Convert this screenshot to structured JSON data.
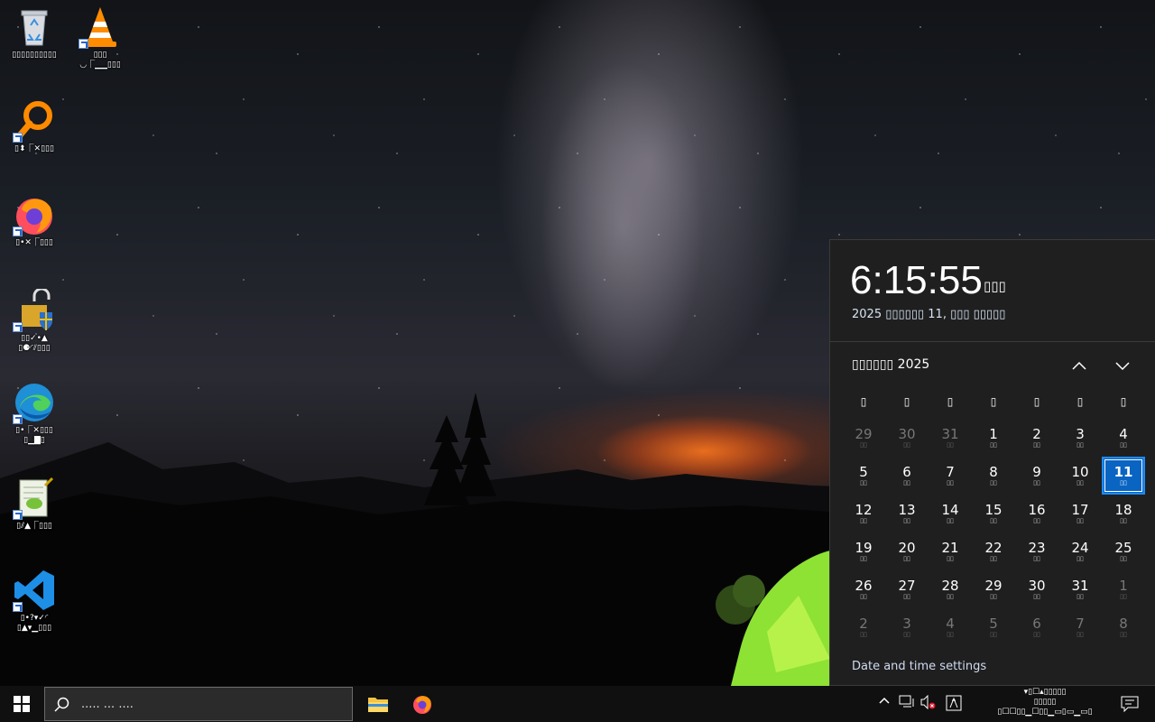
{
  "desktop": {
    "icons": [
      {
        "name": "recycle-bin",
        "label": "▯▯▯▯▯▯▯▯▯▯"
      },
      {
        "name": "vlc",
        "label": "▯▯▯\n◡⎾▁▁▯▯▯"
      },
      {
        "name": "search-app",
        "label": "▯⬍⎾✕▯▯▯"
      },
      {
        "name": "firefox",
        "label": "▯•✕⎾▯▯▯"
      },
      {
        "name": "security-app",
        "label": "▯▯✓•▲\n▯⚈◜⫽▯▯▯"
      },
      {
        "name": "edge",
        "label": "▯•⎾✕▯▯▯\n▯▁▇▯"
      },
      {
        "name": "notepad-app",
        "label": "▯⫽▲⎾▯▯▯"
      },
      {
        "name": "vscode",
        "label": "▯•?▾✓◜\n▯▲▾▁▯▯▯"
      }
    ]
  },
  "flyout": {
    "time": "6:15:55",
    "ampm": "▯▯▯",
    "date": "2025 ▯▯▯▯▯▯ 11, ▯▯▯ ▯▯▯▯▯",
    "month_title": "▯▯▯▯▯▯ 2025",
    "weekdays": [
      "▯",
      "▯",
      "▯",
      "▯",
      "▯",
      "▯",
      "▯"
    ],
    "days": [
      {
        "n": "29",
        "s": "▯▯",
        "dim": true
      },
      {
        "n": "30",
        "s": "▯▯",
        "dim": true
      },
      {
        "n": "31",
        "s": "▯▯",
        "dim": true
      },
      {
        "n": "1",
        "s": "▯▯"
      },
      {
        "n": "2",
        "s": "▯▯"
      },
      {
        "n": "3",
        "s": "▯▯"
      },
      {
        "n": "4",
        "s": "▯▯"
      },
      {
        "n": "5",
        "s": "▯▯"
      },
      {
        "n": "6",
        "s": "▯▯"
      },
      {
        "n": "7",
        "s": "▯▯"
      },
      {
        "n": "8",
        "s": "▯▯"
      },
      {
        "n": "9",
        "s": "▯▯"
      },
      {
        "n": "10",
        "s": "▯▯"
      },
      {
        "n": "11",
        "s": "▯▯",
        "today": true
      },
      {
        "n": "12",
        "s": "▯▯"
      },
      {
        "n": "13",
        "s": "▯▯"
      },
      {
        "n": "14",
        "s": "▯▯"
      },
      {
        "n": "15",
        "s": "▯▯"
      },
      {
        "n": "16",
        "s": "▯▯"
      },
      {
        "n": "17",
        "s": "▯▯"
      },
      {
        "n": "18",
        "s": "▯▯"
      },
      {
        "n": "19",
        "s": "▯▯"
      },
      {
        "n": "20",
        "s": "▯▯"
      },
      {
        "n": "21",
        "s": "▯▯"
      },
      {
        "n": "22",
        "s": "▯▯"
      },
      {
        "n": "23",
        "s": "▯▯"
      },
      {
        "n": "24",
        "s": "▯▯"
      },
      {
        "n": "25",
        "s": "▯▯"
      },
      {
        "n": "26",
        "s": "▯▯"
      },
      {
        "n": "27",
        "s": "▯▯"
      },
      {
        "n": "28",
        "s": "▯▯"
      },
      {
        "n": "29",
        "s": "▯▯"
      },
      {
        "n": "30",
        "s": "▯▯"
      },
      {
        "n": "31",
        "s": "▯▯"
      },
      {
        "n": "1",
        "s": "▯▯",
        "dim": true
      },
      {
        "n": "2",
        "s": "▯▯",
        "dim": true
      },
      {
        "n": "3",
        "s": "▯▯",
        "dim": true
      },
      {
        "n": "4",
        "s": "▯▯",
        "dim": true
      },
      {
        "n": "5",
        "s": "▯▯",
        "dim": true
      },
      {
        "n": "6",
        "s": "▯▯",
        "dim": true
      },
      {
        "n": "7",
        "s": "▯▯",
        "dim": true
      },
      {
        "n": "8",
        "s": "▯▯",
        "dim": true
      }
    ],
    "settings_link": "Date and time settings"
  },
  "taskbar": {
    "search_placeholder": "..... ... ....",
    "tray_clock": "▾▯☐▴▯▯▯▯▯\n▯▯▯▯▯\n▯☐☐▯▯▁☐▯▯▁▭▯▭▁▭▯",
    "accent": "#0a64c2"
  }
}
